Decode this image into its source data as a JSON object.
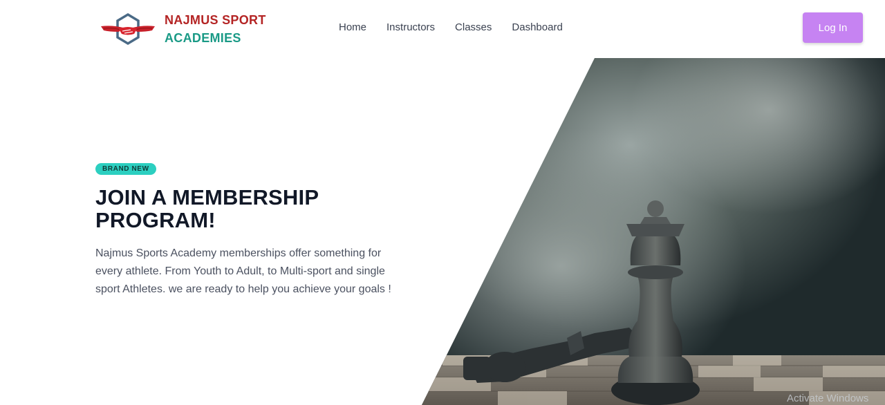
{
  "brand": {
    "line1": "NAJMUS SPORT",
    "line2": "ACADEMIES",
    "primary_color": "#b42424",
    "secondary_color": "#1a9a86",
    "logo_icon": "handshake-wings-icon"
  },
  "nav": {
    "items": [
      {
        "label": "Home"
      },
      {
        "label": "Instructors"
      },
      {
        "label": "Classes"
      },
      {
        "label": "Dashboard"
      }
    ]
  },
  "header": {
    "login_label": "Log In",
    "login_color": "#c683f2"
  },
  "hero": {
    "badge": "BRAND NEW",
    "badge_color": "#2ccfc0",
    "title": "JOIN A MEMBERSHIP PROGRAM!",
    "description": "Najmus Sports Academy memberships offer something for every athlete. From Youth to Adult, to Multi-sport and single sport Athletes. we are ready to help you achieve your goals !",
    "image": "chess-pieces-smoke-image"
  },
  "watermark": "Activate Windows"
}
